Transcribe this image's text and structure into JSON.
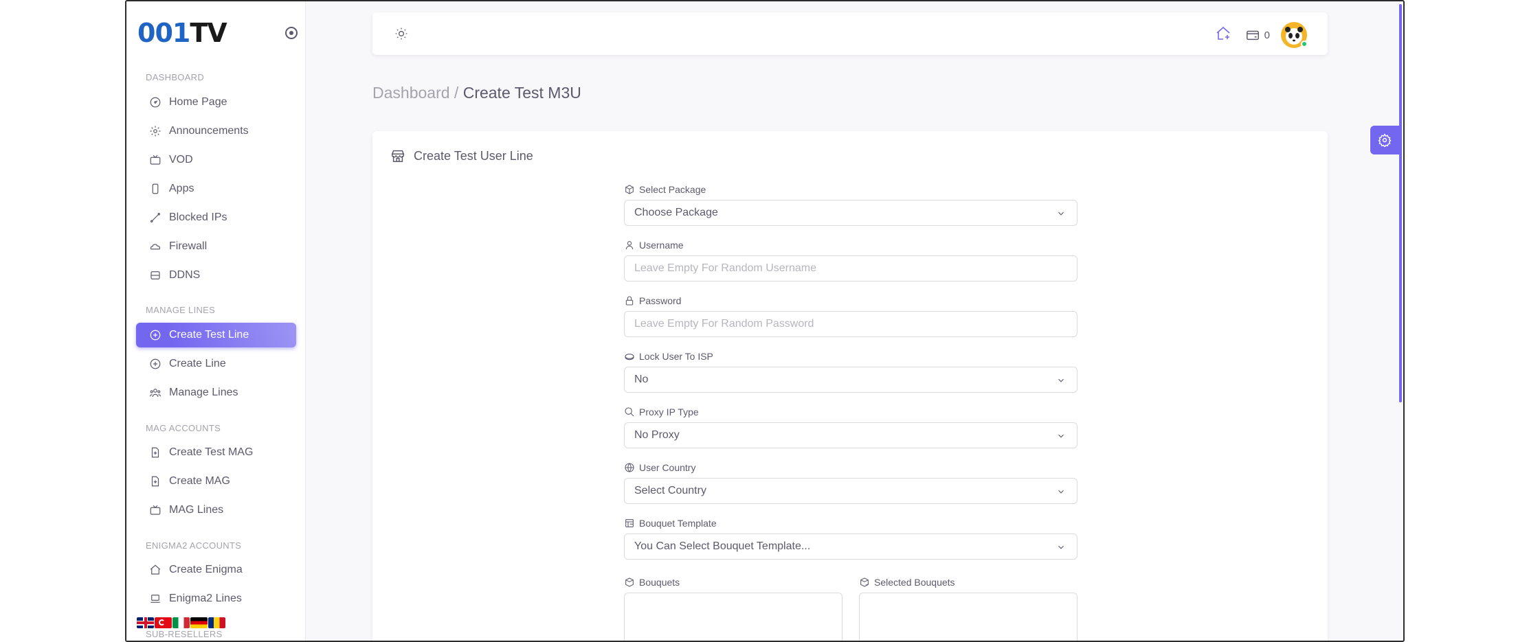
{
  "brand": {
    "part1": "001",
    "part2": "TV"
  },
  "sidebar": {
    "sections": [
      {
        "header": "DASHBOARD",
        "items": [
          {
            "label": "Home Page",
            "icon": "gauge-icon"
          },
          {
            "label": "Announcements",
            "icon": "gear-icon"
          },
          {
            "label": "VOD",
            "icon": "tv-icon"
          },
          {
            "label": "Apps",
            "icon": "phone-icon"
          },
          {
            "label": "Blocked IPs",
            "icon": "slash-icon"
          },
          {
            "label": "Firewall",
            "icon": "cloud-icon"
          },
          {
            "label": "DDNS",
            "icon": "server-icon"
          }
        ]
      },
      {
        "header": "MANAGE LINES",
        "items": [
          {
            "label": "Create Test Line",
            "icon": "plus-circle-icon",
            "active": true
          },
          {
            "label": "Create Line",
            "icon": "plus-circle-icon"
          },
          {
            "label": "Manage Lines",
            "icon": "users-icon"
          }
        ]
      },
      {
        "header": "MAG ACCOUNTS",
        "items": [
          {
            "label": "Create Test MAG",
            "icon": "file-plus-icon"
          },
          {
            "label": "Create MAG",
            "icon": "file-plus-icon"
          },
          {
            "label": "MAG Lines",
            "icon": "tv-icon"
          }
        ]
      },
      {
        "header": "ENIGMA2 ACCOUNTS",
        "items": [
          {
            "label": "Create Enigma",
            "icon": "home-icon"
          },
          {
            "label": "Enigma2 Lines",
            "icon": "laptop-icon"
          }
        ]
      },
      {
        "header": "SUB-RESELLERS",
        "items": []
      }
    ],
    "flags": [
      "uk-flag",
      "turkey-flag",
      "italy-flag",
      "germany-flag",
      "romania-flag"
    ]
  },
  "navbar": {
    "credits": "0"
  },
  "breadcrumb": {
    "parent": "Dashboard /",
    "current": "Create Test M3U"
  },
  "card": {
    "title": "Create Test User Line",
    "fields": [
      {
        "label": "Select Package",
        "value": "Choose Package",
        "type": "select",
        "icon": "box-icon"
      },
      {
        "label": "Username",
        "placeholder": "Leave Empty For Random Username",
        "type": "input",
        "icon": "user-icon"
      },
      {
        "label": "Password",
        "placeholder": "Leave Empty For Random Password",
        "type": "input",
        "icon": "lock-icon"
      },
      {
        "label": "Lock User To ISP",
        "value": "No",
        "type": "select",
        "icon": "disc-icon"
      },
      {
        "label": "Proxy IP Type",
        "value": "No Proxy",
        "type": "select",
        "icon": "search-icon"
      },
      {
        "label": "User Country",
        "value": "Select Country",
        "type": "select",
        "icon": "globe-icon"
      },
      {
        "label": "Bouquet Template",
        "value": "You Can Select Bouquet Template...",
        "type": "select",
        "icon": "layout-icon"
      }
    ],
    "bouquets_label": "Bouquets",
    "selected_bouquets_label": "Selected Bouquets"
  },
  "colors": {
    "accent": "#7367f0",
    "brand_blue": "#1f64c4",
    "online": "#28c76f"
  }
}
